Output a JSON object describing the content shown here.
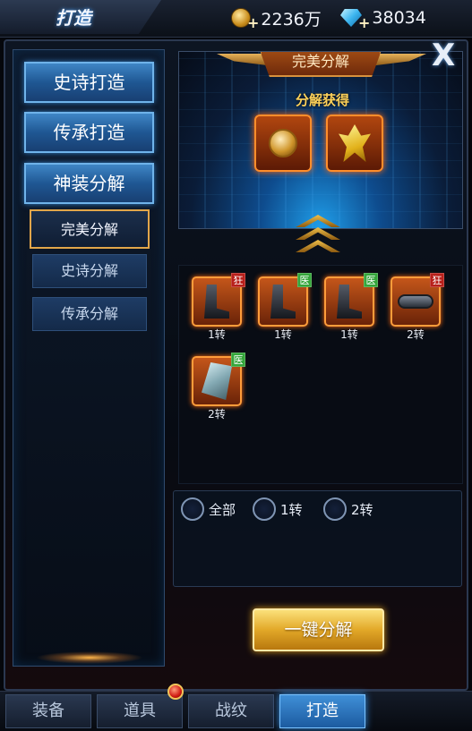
{
  "header": {
    "title": "打造",
    "gold": {
      "icon": "gold-coin-icon",
      "value": "2236万",
      "plus": "+"
    },
    "gems": {
      "icon": "diamond-icon",
      "value": "38034",
      "plus": "+"
    }
  },
  "sidebar": {
    "main_buttons": [
      {
        "label": "史诗打造"
      },
      {
        "label": "传承打造"
      },
      {
        "label": "神装分解"
      }
    ],
    "sub_buttons": [
      {
        "label": "完美分解",
        "active": true
      },
      {
        "label": "史诗分解",
        "active": false
      },
      {
        "label": "传承分解",
        "active": false
      }
    ]
  },
  "preview": {
    "banner": "完美分解",
    "gain_label": "分解获得",
    "rewards": [
      {
        "icon": "medal-icon"
      },
      {
        "icon": "crystal-icon"
      }
    ]
  },
  "close": {
    "label": "X"
  },
  "items": [
    {
      "icon": "boots-icon",
      "tag": "狂",
      "tag_color": "#b8201b",
      "label": "1转"
    },
    {
      "icon": "boots-icon",
      "tag": "医",
      "tag_color": "#35a63b",
      "label": "1转"
    },
    {
      "icon": "boots-icon",
      "tag": "医",
      "tag_color": "#35a63b",
      "label": "1转"
    },
    {
      "icon": "belt-icon",
      "tag": "狂",
      "tag_color": "#b8201b",
      "label": "2转"
    },
    {
      "icon": "gauntlet-icon",
      "tag": "医",
      "tag_color": "#35a63b",
      "label": "2转"
    }
  ],
  "filters": [
    {
      "label": "全部"
    },
    {
      "label": "1转"
    },
    {
      "label": "2转"
    }
  ],
  "actions": {
    "decompose": "一键分解"
  },
  "tabs": [
    {
      "label": "装备",
      "active": false
    },
    {
      "label": "道具",
      "active": false
    },
    {
      "label": "战纹",
      "active": false
    },
    {
      "label": "打造",
      "active": true
    }
  ]
}
